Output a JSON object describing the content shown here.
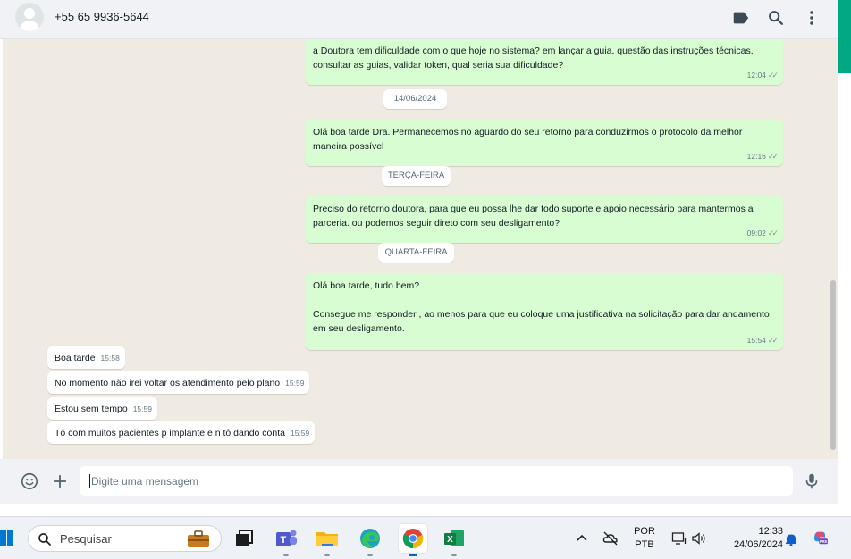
{
  "header": {
    "contact_name": "+55 65 9936-5644",
    "icons": [
      "label-icon",
      "search-icon",
      "menu-icon"
    ]
  },
  "messages": [
    {
      "direction": "out",
      "text": "a Doutora tem dificuldade com o que hoje no sistema? em lançar a guia, questão das instruções técnicas, consultar as guias, validar token, qual seria sua dificuldade?",
      "time": "12:04",
      "status": "read"
    },
    {
      "type": "date",
      "text": "14/06/2024"
    },
    {
      "direction": "out",
      "text": "Olá boa tarde Dra. Permanecemos no aguardo do seu retorno para conduzirmos o protocolo da melhor maneira possível",
      "time": "12:16",
      "status": "read"
    },
    {
      "type": "date",
      "text": "TERÇA-FEIRA"
    },
    {
      "direction": "out",
      "text": "Preciso do retorno doutora, para que eu possa lhe dar todo suporte e apoio necessário para mantermos a parceria. ou podemos seguir direto com seu desligamento?",
      "time": "09:02",
      "status": "read"
    },
    {
      "type": "date",
      "text": "QUARTA-FEIRA"
    },
    {
      "direction": "out",
      "text": "Olá boa tarde, tudo bem?\n\nConsegue me responder , ao menos para que eu coloque uma justificativa na solicitação para dar andamento em seu desligamento.",
      "time": "15:54",
      "status": "read"
    },
    {
      "direction": "in",
      "text": "Boa tarde",
      "time": "15:58"
    },
    {
      "direction": "in",
      "text": "No momento não irei voltar os atendimento pelo plano",
      "time": "15:59"
    },
    {
      "direction": "in",
      "text": "Estou sem tempo",
      "time": "15:59"
    },
    {
      "direction": "in",
      "text": "Tô com muitos pacientes p implante e n tô dando conta",
      "time": "15:59"
    }
  ],
  "compose": {
    "placeholder": "Digite uma mensagem",
    "value": "",
    "icons": [
      "emoji-icon",
      "attach-plus-icon",
      "microphone-icon"
    ]
  },
  "taskbar": {
    "search_label": "Pesquisar",
    "apps": [
      "file-manager-icon",
      "teams-icon",
      "file-explorer-icon",
      "edge-icon",
      "chrome-icon",
      "excel-icon"
    ],
    "active_app": "chrome-icon",
    "language_line1": "POR",
    "language_line2": "PTB",
    "time": "12:33",
    "date": "24/06/2024",
    "colors": {
      "whatsapp_green": "#00a884",
      "outgoing_bubble": "#d9fdd3",
      "chat_bg": "#efeae2",
      "header_bg": "#f0f2f5"
    }
  }
}
